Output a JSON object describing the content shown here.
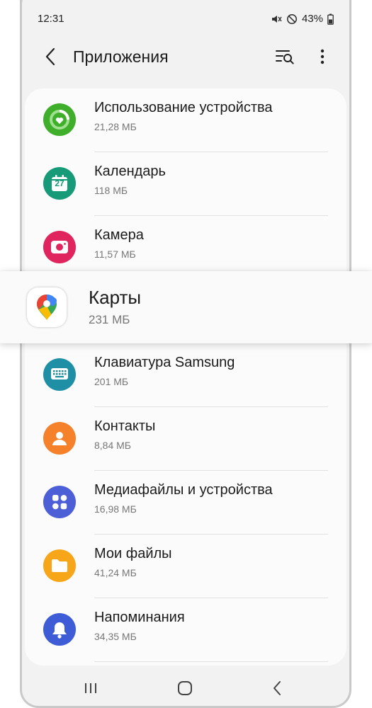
{
  "status": {
    "time": "12:31",
    "battery": "43%"
  },
  "header": {
    "title": "Приложения"
  },
  "apps": [
    {
      "name": "Использование устройства",
      "size": "21,28 МБ",
      "icon": "device-usage-icon",
      "color": "#3fae2a"
    },
    {
      "name": "Календарь",
      "size": "118 МБ",
      "icon": "calendar-icon",
      "color": "#169a78",
      "day": "27"
    },
    {
      "name": "Камера",
      "size": "11,57 МБ",
      "icon": "camera-icon",
      "color": "#e0245e"
    },
    {
      "name": "Клавиатура Samsung",
      "size": "201 МБ",
      "icon": "keyboard-icon",
      "color": "#1f8fa6"
    },
    {
      "name": "Контакты",
      "size": "8,84 МБ",
      "icon": "contacts-icon",
      "color": "#f5812a"
    },
    {
      "name": "Медиафайлы и устройства",
      "size": "16,98 МБ",
      "icon": "media-devices-icon",
      "color": "#4d5fd6"
    },
    {
      "name": "Мои файлы",
      "size": "41,24 МБ",
      "icon": "my-files-icon",
      "color": "#f8a619"
    },
    {
      "name": "Напоминания",
      "size": "34,35 МБ",
      "icon": "reminder-icon",
      "color": "#3d5cd6"
    }
  ],
  "highlighted": {
    "name": "Карты",
    "size": "231 МБ",
    "icon": "maps-icon"
  }
}
